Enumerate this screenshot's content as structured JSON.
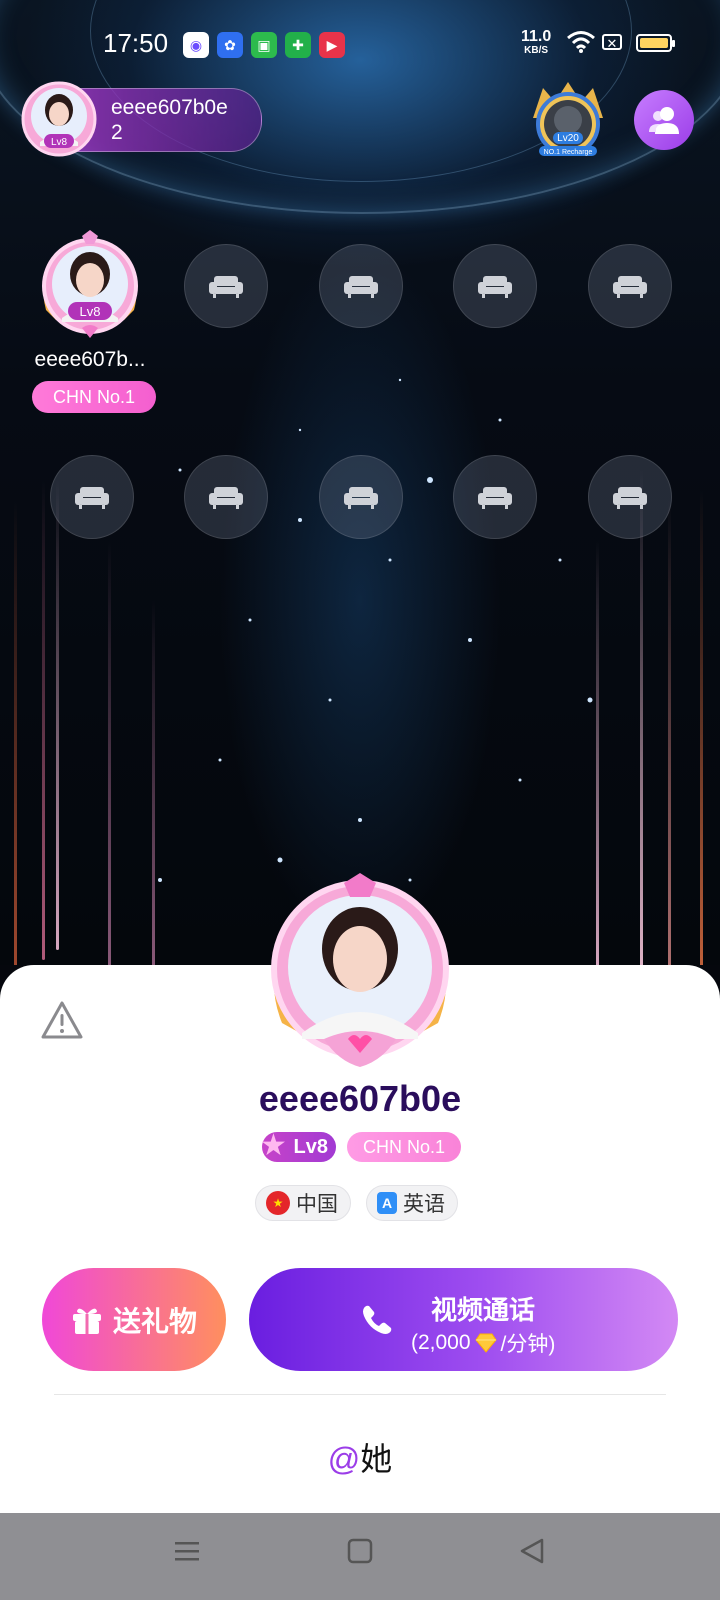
{
  "status_bar": {
    "time": "17:50",
    "net_speed_value": "11.0",
    "net_speed_unit": "KB/S",
    "icons": [
      "nfc-app-icon",
      "baidu-icon",
      "market-icon",
      "shield-app-icon",
      "video-app-icon",
      "wifi-icon",
      "no-sim-icon",
      "battery-icon"
    ]
  },
  "room": {
    "host_name_line1": "eeee607b0e",
    "host_name_line2": "2",
    "host_level": "Lv8",
    "badge_level": "Lv20",
    "badge_caption": "NO.1 Recharge"
  },
  "seats": {
    "occupied": {
      "name": "eeee607b...",
      "level": "Lv8",
      "rank": "CHN No.1"
    },
    "empty_count": 9
  },
  "profile": {
    "name": "eeee607b0e",
    "level": "Lv8",
    "rank": "CHN No.1",
    "country": "中国",
    "language": "英语",
    "gift_label": "送礼物",
    "call_label": "视频通话",
    "call_price_prefix": "(2,000",
    "call_price_suffix": "/分钟)",
    "mention_at": "@",
    "mention_label": "她"
  },
  "colors": {
    "accent_purple": "#9b3de8",
    "name_color": "#2a0d5c",
    "gift_gradient": [
      "#f048d8",
      "#ff8f5e"
    ],
    "call_gradient": [
      "#6a1ee0",
      "#d389f4"
    ]
  }
}
